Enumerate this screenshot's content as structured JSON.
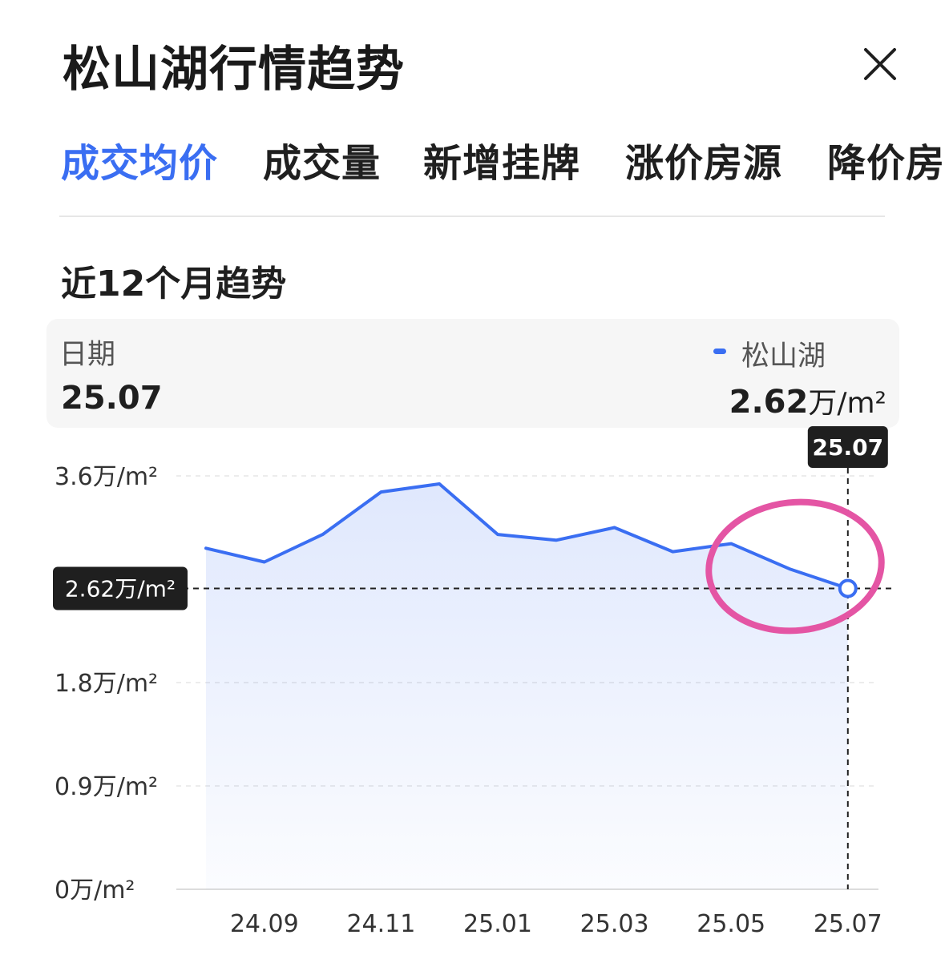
{
  "header": {
    "title": "松山湖行情趋势",
    "close_icon": "close-icon"
  },
  "tabs": [
    {
      "label": "成交均价",
      "active": true
    },
    {
      "label": "成交量",
      "active": false
    },
    {
      "label": "新增挂牌",
      "active": false
    },
    {
      "label": "涨价房源",
      "active": false
    },
    {
      "label": "降价房",
      "active": false
    }
  ],
  "section": {
    "title": "近12个月趋势"
  },
  "info_card": {
    "date_label": "日期",
    "date_value": "25.07",
    "legend_name": "松山湖",
    "value_number": "2.62",
    "value_unit": "万/m²"
  },
  "colors": {
    "accent": "#3a6ef2",
    "annotation_circle": "#e455a4",
    "tooltip_bg": "#1f1f1f"
  },
  "chart_data": {
    "type": "area",
    "x": [
      "24.08",
      "24.09",
      "24.10",
      "24.11",
      "24.12",
      "25.01",
      "25.02",
      "25.03",
      "25.04",
      "25.05",
      "25.06",
      "25.07"
    ],
    "x_tick_labels": [
      "24.09",
      "24.11",
      "25.01",
      "25.03",
      "25.05",
      "25.07"
    ],
    "series": [
      {
        "name": "松山湖",
        "values": [
          2.97,
          2.85,
          3.09,
          3.46,
          3.53,
          3.09,
          3.04,
          3.15,
          2.94,
          3.01,
          2.79,
          2.62
        ]
      }
    ],
    "y_tick_labels": [
      "3.6万/m²",
      "1.8万/m²",
      "0.9万/m²",
      "0万/m²"
    ],
    "ylim": [
      0,
      3.6
    ],
    "grid": true,
    "selected": {
      "x": "25.07",
      "y": 2.62,
      "x_label": "25.07",
      "y_label": "2.62万/m²"
    }
  }
}
